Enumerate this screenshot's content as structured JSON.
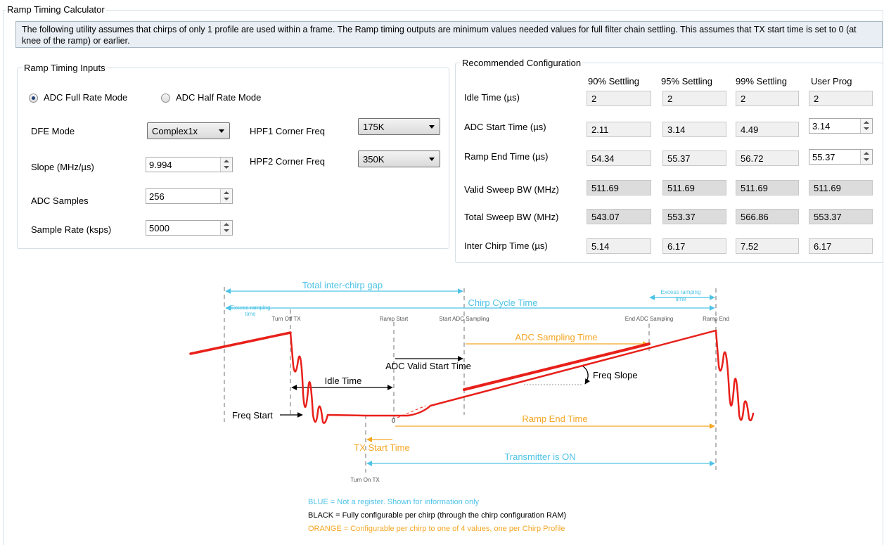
{
  "window_title": "Ramp Timing Calculator",
  "info_text": "The following utility assumes that chirps of only 1 profile are used within a frame.  The Ramp timing outputs are minimum values needed values for full filter chain settling. This assumes that TX start time is set to 0 (at knee of the ramp) or earlier.",
  "inputs": {
    "group_title": "Ramp Timing Inputs",
    "radio_full": "ADC Full Rate Mode",
    "radio_half": "ADC Half Rate Mode",
    "selected_mode": "ADC Full Rate Mode",
    "dfe_label": "DFE Mode",
    "dfe_value": "Complex1x",
    "slope_label": "Slope (MHz/µs)",
    "slope_value": "9.994",
    "adc_samples_label": "ADC Samples",
    "adc_samples_value": "256",
    "sample_rate_label": "Sample Rate (ksps)",
    "sample_rate_value": "5000",
    "hpf1_label": "HPF1 Corner Freq",
    "hpf1_value": "175K",
    "hpf2_label": "HPF2 Corner Freq",
    "hpf2_value": "350K"
  },
  "config": {
    "group_title": "Recommended Configuration",
    "columns": [
      "90% Settling",
      "95% Settling",
      "99% Settling",
      "User Prog"
    ],
    "rows": [
      {
        "label": "Idle Time  (µs)",
        "values": [
          "2",
          "2",
          "2",
          "2"
        ]
      },
      {
        "label": "ADC Start Time (µs)",
        "values": [
          "2.11",
          "3.14",
          "4.49",
          "3.14"
        ]
      },
      {
        "label": "Ramp End Time (µs)",
        "values": [
          "54.34",
          "55.37",
          "56.72",
          "55.37"
        ]
      },
      {
        "label": "Valid Sweep BW (MHz)",
        "values": [
          "511.69",
          "511.69",
          "511.69",
          "511.69"
        ]
      },
      {
        "label": "Total Sweep BW (MHz)",
        "values": [
          "543.07",
          "553.37",
          "566.86",
          "553.37"
        ]
      },
      {
        "label": "Inter Chirp Time (µs)",
        "values": [
          "5.14",
          "6.17",
          "7.52",
          "6.17"
        ]
      }
    ]
  },
  "diagram": {
    "total_gap": "Total inter-chirp gap",
    "chirp_cycle": "Chirp Cycle Time",
    "excess_left_1": "Excess ramping",
    "excess_left_2": "time",
    "excess_right_1": "Excess ramping",
    "excess_right_2": "time",
    "turn_off_tx": "Turn Off TX",
    "ramp_start": "Ramp Start",
    "start_adc": "Start ADC Sampling",
    "end_adc": "End ADC Sampling",
    "ramp_end": "Ramp End",
    "adc_sampling_time": "ADC Sampling Time",
    "adc_valid_start": "ADC Valid Start Time",
    "freq_slope": "Freq Slope",
    "idle_time": "Idle Time",
    "freq_start": "Freq Start",
    "zero": "0",
    "ramp_end_time": "Ramp End Time",
    "tx_start_time": "TX Start Time",
    "transmitter_on": "Transmitter is ON",
    "turn_on_tx": "Turn On TX",
    "legend_blue": "BLUE = Not a register. Shown for information only",
    "legend_black": "BLACK = Fully configurable per chirp (through the chirp configuration RAM)",
    "legend_orange": "ORANGE = Configurable per chirp to one of 4 values, one per Chirp Profile",
    "colors": {
      "blue": "#4ec3e6",
      "orange": "#f5a623",
      "red": "#e8201a",
      "gray": "#8a8a8a"
    }
  }
}
